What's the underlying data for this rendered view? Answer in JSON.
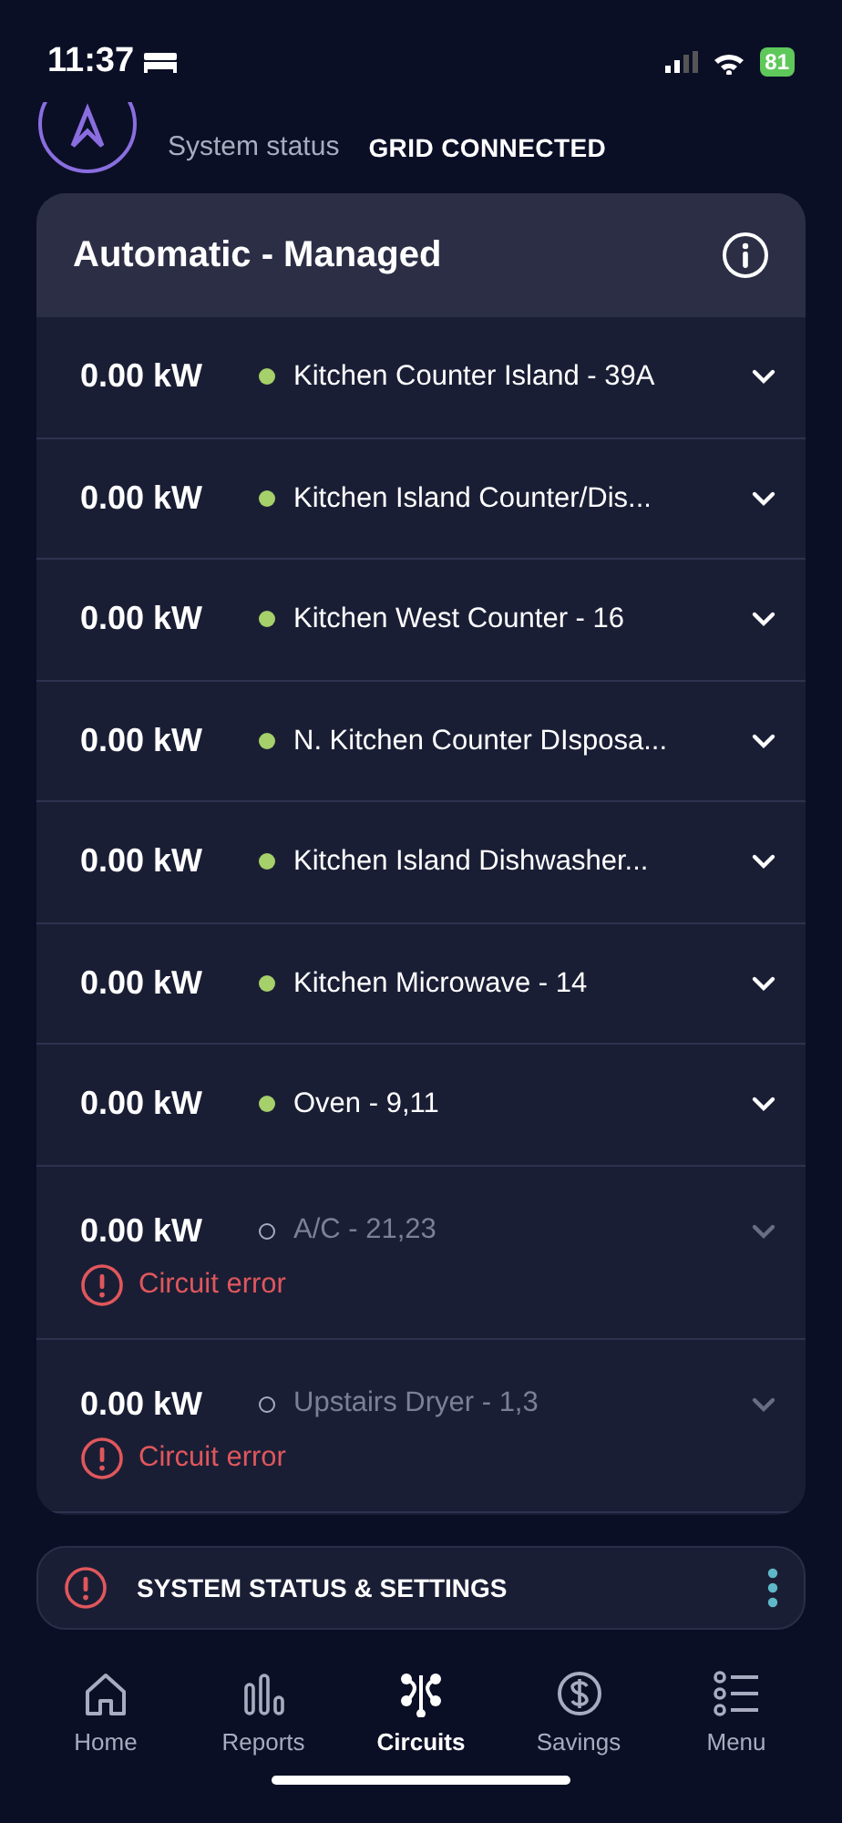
{
  "status_bar": {
    "time": "11:37",
    "battery": "81"
  },
  "system": {
    "label": "System status",
    "value": "GRID CONNECTED"
  },
  "panel": {
    "title": "Automatic - Managed"
  },
  "circuits": [
    {
      "power": "0.00 kW",
      "name": "Kitchen Counter Island - 39A",
      "online": true
    },
    {
      "power": "0.00 kW",
      "name": "Kitchen Island Counter/Dis...",
      "online": true
    },
    {
      "power": "0.00 kW",
      "name": "Kitchen West Counter - 16",
      "online": true
    },
    {
      "power": "0.00 kW",
      "name": "N. Kitchen Counter DIsposa...",
      "online": true
    },
    {
      "power": "0.00 kW",
      "name": "Kitchen Island Dishwasher...",
      "online": true
    },
    {
      "power": "0.00 kW",
      "name": "Kitchen Microwave - 14",
      "online": true
    },
    {
      "power": "0.00 kW",
      "name": "Oven - 9,11",
      "online": true
    },
    {
      "power": "0.00 kW",
      "name": "A/C - 21,23",
      "online": false,
      "error": "Circuit error"
    },
    {
      "power": "0.00 kW",
      "name": "Upstairs Dryer - 1,3",
      "online": false,
      "error": "Circuit error"
    }
  ],
  "banner": {
    "label": "SYSTEM STATUS & SETTINGS"
  },
  "tabs": [
    {
      "label": "Home",
      "kind": "home",
      "selected": false
    },
    {
      "label": "Reports",
      "kind": "reports",
      "selected": false
    },
    {
      "label": "Circuits",
      "kind": "circuits",
      "selected": true
    },
    {
      "label": "Savings",
      "kind": "savings",
      "selected": false
    },
    {
      "label": "Menu",
      "kind": "menu",
      "selected": false
    }
  ]
}
